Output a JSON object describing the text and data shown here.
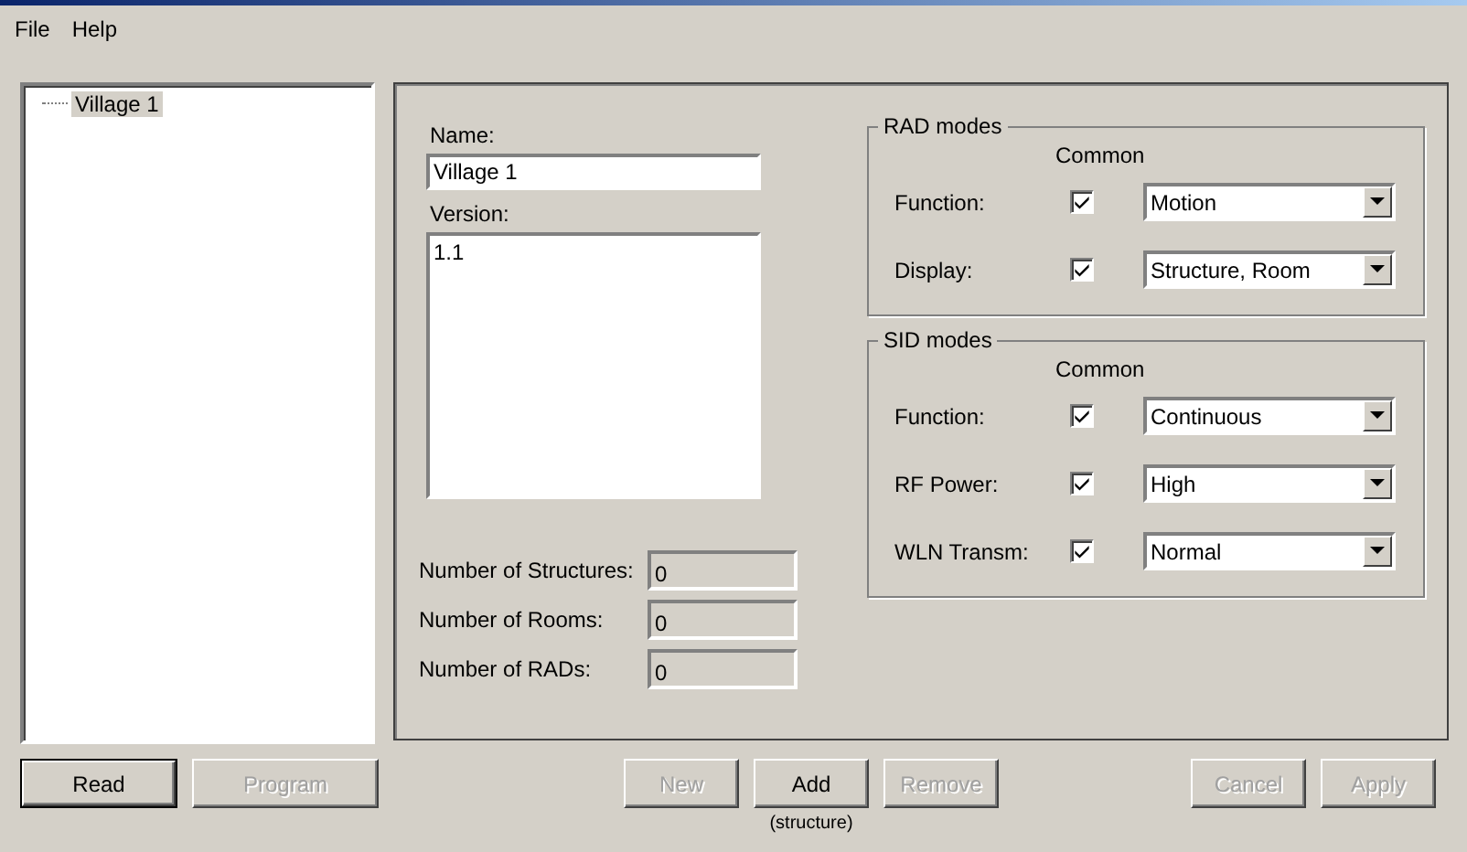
{
  "menu": [
    {
      "label": "File"
    },
    {
      "label": "Help"
    }
  ],
  "tree": {
    "items": [
      {
        "label": "Village 1",
        "selected": true
      }
    ]
  },
  "details": {
    "name": {
      "label": "Name:",
      "value": "Village 1"
    },
    "version": {
      "label": "Version:",
      "value": "1.1"
    },
    "counts": [
      {
        "label": "Number of Structures:",
        "value": "0",
        "disabled": true
      },
      {
        "label": "Number of Rooms:",
        "value": "0",
        "disabled": true
      },
      {
        "label": "Number of RADs:",
        "value": "0",
        "disabled": true
      }
    ]
  },
  "groups": [
    {
      "title": "RAD modes",
      "column_heading": "Common",
      "rows": [
        {
          "label": "Function:",
          "checked": true,
          "value": "Motion"
        },
        {
          "label": "Display:",
          "checked": true,
          "value": "Structure, Room"
        }
      ]
    },
    {
      "title": "SID modes",
      "column_heading": "Common",
      "rows": [
        {
          "label": "Function:",
          "checked": true,
          "value": "Continuous"
        },
        {
          "label": "RF Power:",
          "checked": true,
          "value": "High"
        },
        {
          "label": "WLN Transm:",
          "checked": true,
          "value": "Normal"
        }
      ]
    }
  ],
  "left_buttons": [
    {
      "label": "Read",
      "disabled": false,
      "default": true
    },
    {
      "label": "Program",
      "disabled": true,
      "default": false
    }
  ],
  "center_buttons": [
    {
      "label": "New",
      "disabled": true,
      "default": false
    },
    {
      "label": "Add",
      "disabled": false,
      "default": false,
      "note": "(structure)"
    },
    {
      "label": "Remove",
      "disabled": true,
      "default": false
    }
  ],
  "right_buttons": [
    {
      "label": "Cancel",
      "disabled": true,
      "default": false
    },
    {
      "label": "Apply",
      "disabled": true,
      "default": false
    }
  ]
}
